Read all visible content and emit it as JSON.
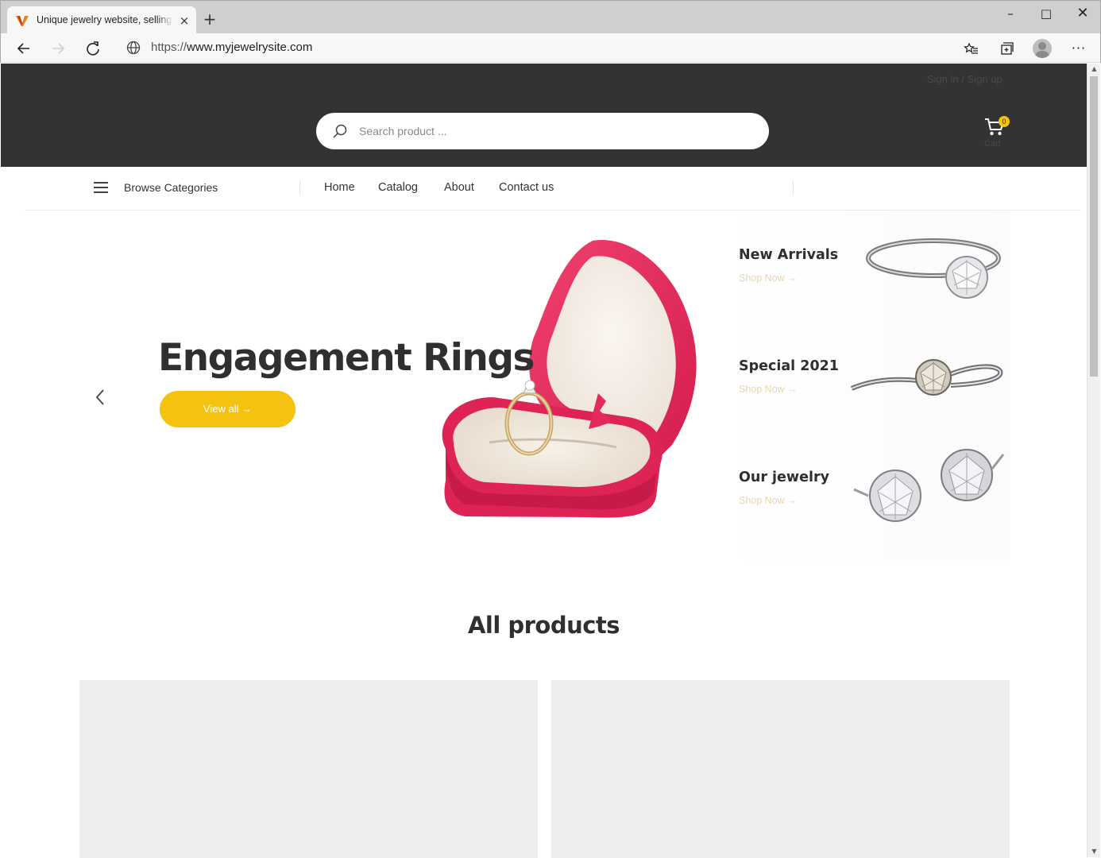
{
  "browser": {
    "tab_title": "Unique jewelry website, selling jewelry",
    "tab_close": "×",
    "new_tab": "+",
    "window_minimize": "–",
    "window_maximize": "□",
    "window_close": "✕",
    "url_scheme": "https://",
    "url_host": "www.myjewelrysite.com",
    "more_menu": "···"
  },
  "header": {
    "signin_link": "Sign in / Sign up",
    "search_placeholder": "Search product ...",
    "cart_count": "0",
    "cart_label": "Cart"
  },
  "nav": {
    "browse_categories": "Browse Categories",
    "links": [
      "Home",
      "Catalog",
      "About",
      "Contact us"
    ]
  },
  "hero": {
    "title": "Engagement Rings",
    "button_label": "View all  →"
  },
  "promos": [
    {
      "title": "New Arrivals",
      "link": "Shop Now  →"
    },
    {
      "title": "Special 2021",
      "link": "Shop Now  →"
    },
    {
      "title": "Our jewelry",
      "link": "Shop Now  →"
    }
  ],
  "products": {
    "section_title": "All products"
  },
  "colors": {
    "header_bg": "#333333",
    "accent_yellow": "#f5c20f",
    "ring_box_pink": "#e8285a",
    "card_bg": "#eeedef"
  },
  "icons": {
    "back": "arrow-left-icon",
    "forward": "arrow-right-icon",
    "reload": "reload-icon",
    "site_info": "globe-icon",
    "favorites": "star-list-icon",
    "collections": "collections-icon",
    "profile": "avatar-icon",
    "search": "search-icon",
    "cart": "cart-icon",
    "menu": "hamburger-icon",
    "slider_prev": "chevron-left-icon"
  }
}
